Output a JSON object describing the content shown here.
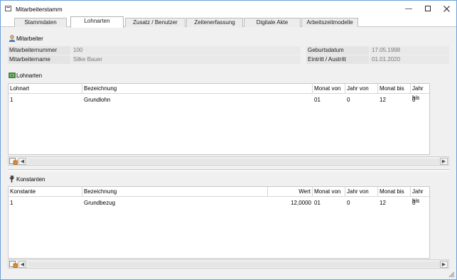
{
  "window": {
    "title": "Mitarbeiterstamm"
  },
  "tabs": [
    {
      "label": "Stammdaten"
    },
    {
      "label": "Lohnarten"
    },
    {
      "label": "Zusatz / Benutzer"
    },
    {
      "label": "Zeitenerfassung"
    },
    {
      "label": "Digitale Akte"
    },
    {
      "label": "Arbeitszeitmodelle"
    }
  ],
  "active_tab": "Lohnarten",
  "mitarbeiter": {
    "title": "Mitarbeiter",
    "fields": {
      "nummer": {
        "label": "Mitarbeiternummer",
        "value": "100"
      },
      "name": {
        "label": "Mitarbeitername",
        "value": "Silke Bauer"
      },
      "geburtsdatum": {
        "label": "Geburtsdatum",
        "value": "17.05.1998"
      },
      "eintritt": {
        "label": "Eintritt / Austritt",
        "value": "01.01.2020"
      }
    }
  },
  "lohnarten": {
    "title": "Lohnarten",
    "columns": [
      "Lohnart",
      "Bezeichnung",
      "Monat von",
      "Jahr von",
      "Monat bis",
      "Jahr bis"
    ],
    "rows": [
      [
        "1",
        "Grundlohn",
        "01",
        "0",
        "12",
        "0"
      ]
    ]
  },
  "konstanten": {
    "title": "Konstanten",
    "columns": [
      "Konstante",
      "Bezeichnung",
      "Wert",
      "Monat von",
      "Jahr von",
      "Monat bis",
      "Jahr bis"
    ],
    "rows": [
      [
        "1",
        "Grundbezug",
        "12,0000",
        "01",
        "0",
        "12",
        "0"
      ]
    ]
  },
  "controls": {
    "minimize": "—",
    "scroll_left": "◀",
    "scroll_right": "▶"
  },
  "colors": {
    "window_border": "#6f9fd8",
    "panel_bg": "#f0f0f0",
    "grid_bg": "#ffffff"
  }
}
